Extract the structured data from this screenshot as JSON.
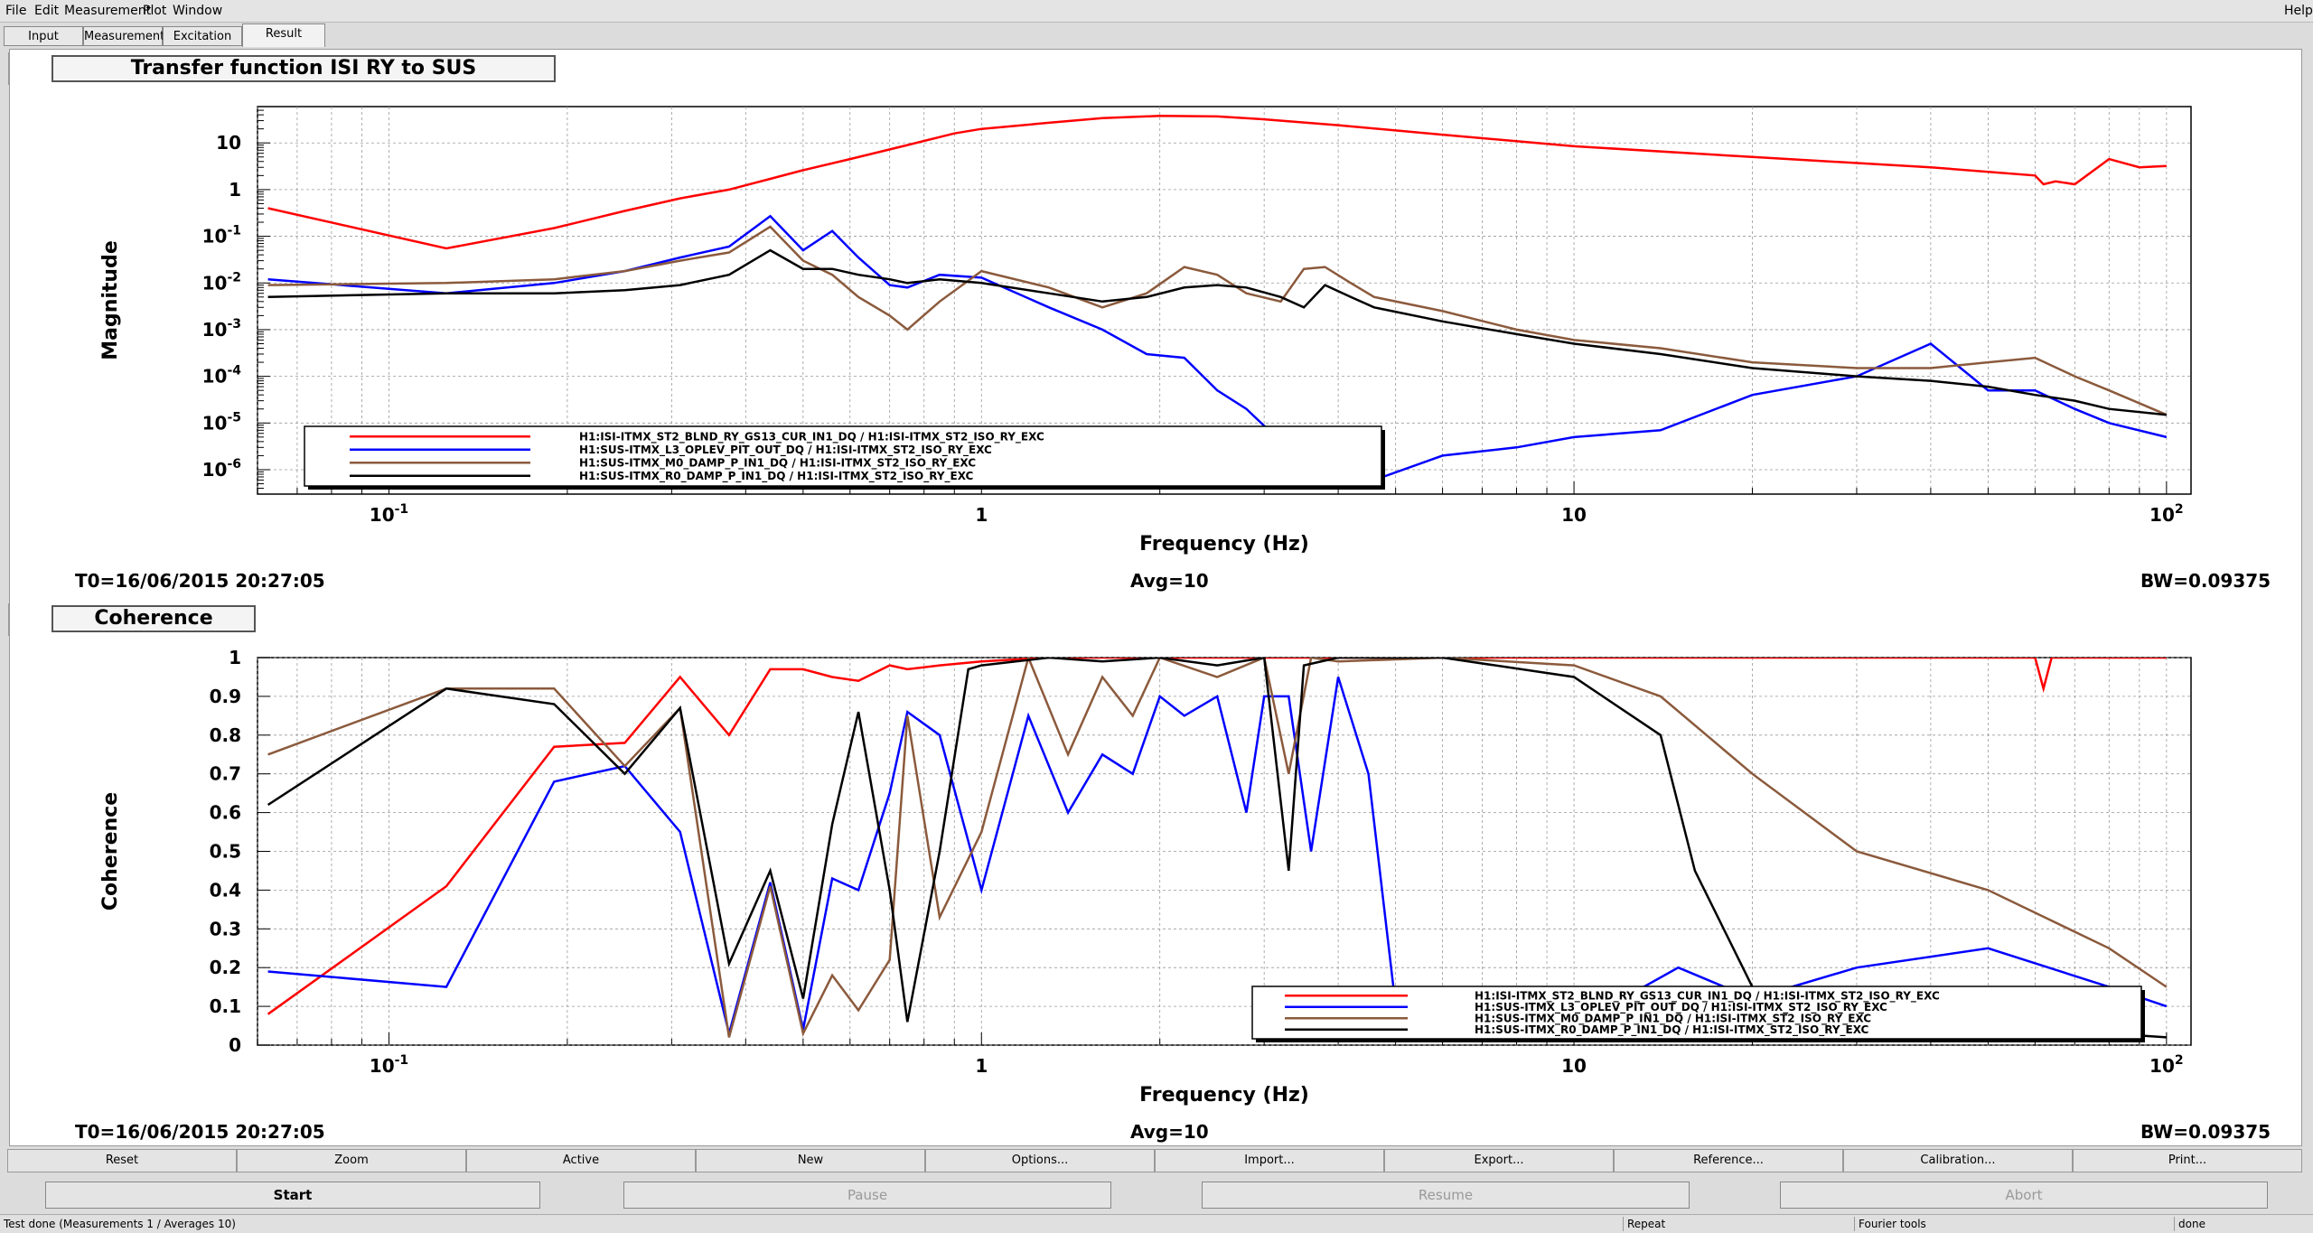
{
  "menu": {
    "file": "File",
    "edit": "Edit",
    "measurement": "Measurement",
    "plot": "Plot",
    "window": "Window",
    "help": "Help"
  },
  "tabs": [
    "Input",
    "Measurement",
    "Excitation",
    "Result"
  ],
  "plots": [
    {
      "title": "Transfer function ISI RY to SUS",
      "ylabel": "Magnitude",
      "xlabel": "Frequency (Hz)",
      "footer": {
        "t0": "T0=16/06/2015 20:27:05",
        "avg": "Avg=10",
        "bw": "BW=0.09375"
      }
    },
    {
      "title": "Coherence",
      "ylabel": "Coherence",
      "xlabel": "Frequency (Hz)",
      "footer": {
        "t0": "T0=16/06/2015 20:27:05",
        "avg": "Avg=10",
        "bw": "BW=0.09375"
      }
    }
  ],
  "chart_data": [
    {
      "type": "line",
      "title": "Transfer function ISI RY to SUS",
      "xlabel": "Frequency (Hz)",
      "ylabel": "Magnitude",
      "xscale": "log",
      "yscale": "log",
      "xlim": [
        0.06,
        110
      ],
      "ylim": [
        3e-07,
        60
      ],
      "xticks": [
        "10^-1",
        "1",
        "10",
        "10^2"
      ],
      "yticks": [
        "10^-6",
        "10^-5",
        "10^-4",
        "10^-3",
        "10^-2",
        "10^-1",
        "1",
        "10"
      ],
      "grid": true,
      "legend": "bottom-left",
      "series": [
        {
          "name": "H1:ISI-ITMX_ST2_BLND_RY_GS13_CUR_IN1_DQ / H1:ISI-ITMX_ST2_ISO_RY_EXC",
          "color": "#ff0000",
          "x": [
            0.0625,
            0.125,
            0.19,
            0.25,
            0.31,
            0.375,
            0.44,
            0.5,
            0.6,
            0.75,
            0.9,
            1.0,
            1.3,
            1.6,
            2.0,
            2.5,
            3.0,
            4.0,
            6.0,
            10,
            20,
            40,
            60,
            62,
            65,
            70,
            80,
            90,
            100
          ],
          "y": [
            0.4,
            0.055,
            0.15,
            0.35,
            0.65,
            1.0,
            1.7,
            2.6,
            4.5,
            9,
            16,
            20,
            27,
            34,
            38,
            37,
            32,
            24,
            15,
            8.5,
            5,
            3,
            2.0,
            1.3,
            1.5,
            1.3,
            4.5,
            3.0,
            3.2
          ]
        },
        {
          "name": "H1:SUS-ITMX_L3_OPLEV_PIT_OUT_DQ / H1:ISI-ITMX_ST2_ISO_RY_EXC",
          "color": "#0000ff",
          "x": [
            0.0625,
            0.125,
            0.19,
            0.25,
            0.31,
            0.375,
            0.44,
            0.5,
            0.56,
            0.62,
            0.7,
            0.75,
            0.85,
            1.0,
            1.3,
            1.6,
            1.9,
            2.2,
            2.5,
            2.8,
            3.2,
            3.5,
            3.8,
            4.2,
            4.6,
            6,
            8,
            10,
            14,
            20,
            30,
            40,
            50,
            60,
            70,
            80,
            100
          ],
          "y": [
            0.012,
            0.006,
            0.01,
            0.018,
            0.035,
            0.06,
            0.27,
            0.05,
            0.13,
            0.035,
            0.009,
            0.008,
            0.015,
            0.013,
            0.003,
            0.001,
            0.0003,
            0.00025,
            5e-05,
            2e-05,
            4e-06,
            3e-06,
            6e-06,
            4e-06,
            6e-07,
            2e-06,
            3e-06,
            5e-06,
            7e-06,
            4e-05,
            0.0001,
            0.0005,
            5e-05,
            5e-05,
            2e-05,
            1e-05,
            5e-06
          ]
        },
        {
          "name": "H1:SUS-ITMX_M0_DAMP_P_IN1_DQ / H1:ISI-ITMX_ST2_ISO_RY_EXC",
          "color": "#8b5a3c",
          "x": [
            0.0625,
            0.125,
            0.19,
            0.25,
            0.31,
            0.375,
            0.44,
            0.5,
            0.56,
            0.62,
            0.7,
            0.75,
            0.85,
            1.0,
            1.3,
            1.6,
            1.9,
            2.2,
            2.5,
            2.8,
            3.2,
            3.5,
            3.8,
            4.2,
            4.6,
            6,
            8,
            10,
            14,
            20,
            30,
            40,
            50,
            60,
            70,
            80,
            100
          ],
          "y": [
            0.009,
            0.01,
            0.012,
            0.018,
            0.03,
            0.045,
            0.16,
            0.03,
            0.015,
            0.005,
            0.002,
            0.001,
            0.004,
            0.018,
            0.008,
            0.003,
            0.006,
            0.022,
            0.015,
            0.006,
            0.004,
            0.02,
            0.022,
            0.01,
            0.005,
            0.0025,
            0.001,
            0.0006,
            0.0004,
            0.0002,
            0.00015,
            0.00015,
            0.0002,
            0.00025,
            0.0001,
            5e-05,
            1.5e-05
          ]
        },
        {
          "name": "H1:SUS-ITMX_R0_DAMP_P_IN1_DQ / H1:ISI-ITMX_ST2_ISO_RY_EXC",
          "color": "#000000",
          "x": [
            0.0625,
            0.125,
            0.19,
            0.25,
            0.31,
            0.375,
            0.44,
            0.5,
            0.56,
            0.62,
            0.7,
            0.75,
            0.85,
            1.0,
            1.3,
            1.6,
            1.9,
            2.2,
            2.5,
            2.8,
            3.2,
            3.5,
            3.8,
            4.2,
            4.6,
            6,
            8,
            10,
            14,
            20,
            30,
            40,
            50,
            60,
            70,
            80,
            100
          ],
          "y": [
            0.005,
            0.006,
            0.006,
            0.007,
            0.009,
            0.015,
            0.05,
            0.02,
            0.02,
            0.015,
            0.012,
            0.01,
            0.012,
            0.01,
            0.006,
            0.004,
            0.005,
            0.008,
            0.009,
            0.008,
            0.005,
            0.003,
            0.009,
            0.005,
            0.003,
            0.0015,
            0.0008,
            0.0005,
            0.0003,
            0.00015,
            0.0001,
            8e-05,
            6e-05,
            4e-05,
            3e-05,
            2e-05,
            1.5e-05
          ]
        }
      ]
    },
    {
      "type": "line",
      "title": "Coherence",
      "xlabel": "Frequency (Hz)",
      "ylabel": "Coherence",
      "xscale": "log",
      "xlim": [
        0.06,
        110
      ],
      "ylim": [
        0,
        1
      ],
      "xticks": [
        "10^-1",
        "1",
        "10",
        "10^2"
      ],
      "yticks": [
        "0",
        "0.1",
        "0.2",
        "0.3",
        "0.4",
        "0.5",
        "0.6",
        "0.7",
        "0.8",
        "0.9",
        "1"
      ],
      "grid": true,
      "legend": "bottom-right",
      "series": [
        {
          "name": "H1:ISI-ITMX_ST2_BLND_RY_GS13_CUR_IN1_DQ / H1:ISI-ITMX_ST2_ISO_RY_EXC",
          "color": "#ff0000",
          "x": [
            0.0625,
            0.125,
            0.19,
            0.25,
            0.31,
            0.375,
            0.44,
            0.5,
            0.56,
            0.62,
            0.7,
            0.75,
            0.85,
            1.0,
            1.3,
            2,
            4,
            10,
            30,
            60,
            62,
            64,
            100
          ],
          "y": [
            0.08,
            0.41,
            0.77,
            0.78,
            0.95,
            0.8,
            0.97,
            0.97,
            0.95,
            0.94,
            0.98,
            0.97,
            0.98,
            0.99,
            1.0,
            1.0,
            1.0,
            1.0,
            1.0,
            1.0,
            0.92,
            1.0,
            1.0
          ]
        },
        {
          "name": "H1:SUS-ITMX_L3_OPLEV_PIT_OUT_DQ / H1:ISI-ITMX_ST2_ISO_RY_EXC",
          "color": "#0000ff",
          "x": [
            0.0625,
            0.125,
            0.19,
            0.25,
            0.31,
            0.375,
            0.44,
            0.5,
            0.56,
            0.62,
            0.7,
            0.75,
            0.85,
            1.0,
            1.2,
            1.4,
            1.6,
            1.8,
            2.0,
            2.2,
            2.5,
            2.8,
            3.0,
            3.3,
            3.6,
            4.0,
            4.5,
            5,
            7,
            10,
            15,
            20,
            30,
            50,
            80,
            100
          ],
          "y": [
            0.19,
            0.15,
            0.68,
            0.72,
            0.55,
            0.03,
            0.42,
            0.04,
            0.43,
            0.4,
            0.65,
            0.86,
            0.8,
            0.4,
            0.85,
            0.6,
            0.75,
            0.7,
            0.9,
            0.85,
            0.9,
            0.6,
            0.9,
            0.9,
            0.5,
            0.95,
            0.7,
            0.1,
            0.15,
            0.05,
            0.2,
            0.12,
            0.2,
            0.25,
            0.15,
            0.1
          ]
        },
        {
          "name": "H1:SUS-ITMX_M0_DAMP_P_IN1_DQ / H1:ISI-ITMX_ST2_ISO_RY_EXC",
          "color": "#8b5a3c",
          "x": [
            0.0625,
            0.125,
            0.19,
            0.25,
            0.31,
            0.375,
            0.44,
            0.5,
            0.56,
            0.62,
            0.7,
            0.75,
            0.85,
            1.0,
            1.2,
            1.4,
            1.6,
            1.8,
            2.0,
            2.5,
            3.0,
            3.3,
            3.6,
            4,
            6,
            10,
            14,
            20,
            30,
            50,
            80,
            100
          ],
          "y": [
            0.75,
            0.92,
            0.92,
            0.72,
            0.87,
            0.02,
            0.41,
            0.03,
            0.18,
            0.09,
            0.22,
            0.85,
            0.33,
            0.55,
            1.0,
            0.75,
            0.95,
            0.85,
            1.0,
            0.95,
            1.0,
            0.7,
            1.0,
            0.99,
            1.0,
            0.98,
            0.9,
            0.7,
            0.5,
            0.4,
            0.25,
            0.15
          ]
        },
        {
          "name": "H1:SUS-ITMX_R0_DAMP_P_IN1_DQ / H1:ISI-ITMX_ST2_ISO_RY_EXC",
          "color": "#000000",
          "x": [
            0.0625,
            0.125,
            0.19,
            0.25,
            0.31,
            0.375,
            0.44,
            0.5,
            0.56,
            0.62,
            0.7,
            0.75,
            0.85,
            0.95,
            1.0,
            1.3,
            1.6,
            2.0,
            2.5,
            3.0,
            3.3,
            3.5,
            4,
            6,
            10,
            14,
            16,
            20,
            30,
            50,
            80,
            100
          ],
          "y": [
            0.62,
            0.92,
            0.88,
            0.7,
            0.87,
            0.21,
            0.45,
            0.12,
            0.57,
            0.86,
            0.4,
            0.06,
            0.5,
            0.97,
            0.98,
            1.0,
            0.99,
            1.0,
            0.98,
            1.0,
            0.45,
            0.98,
            1.0,
            1.0,
            0.95,
            0.8,
            0.45,
            0.15,
            0.1,
            0.05,
            0.03,
            0.02
          ]
        }
      ]
    }
  ],
  "buttons1": [
    "Reset",
    "Zoom",
    "Active",
    "New",
    "Options...",
    "Import...",
    "Export...",
    "Reference...",
    "Calibration...",
    "Print..."
  ],
  "buttons2": [
    "Start",
    "Pause",
    "Resume",
    "Abort"
  ],
  "status": {
    "message": "Test done (Measurements 1 / Averages 10)",
    "repeat": "Repeat",
    "fourier": "Fourier tools",
    "state": "done"
  }
}
